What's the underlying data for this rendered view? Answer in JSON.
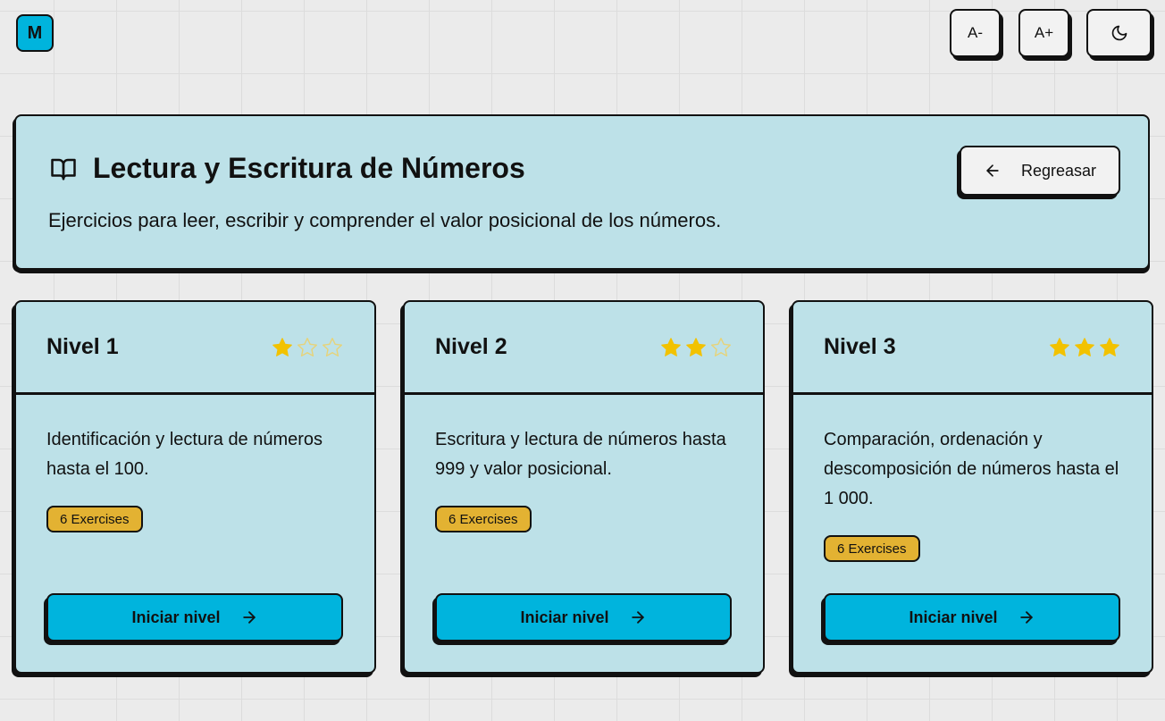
{
  "app": {
    "logo_letter": "M"
  },
  "toolbar": {
    "decrease_font_label": "A-",
    "increase_font_label": "A+",
    "theme_icon": "moon-icon"
  },
  "header": {
    "icon": "book-open-icon",
    "title": "Lectura y Escritura de Números",
    "subtitle": "Ejercicios para leer, escribir y comprender el valor posicional de los números.",
    "back_label": "Regreasar",
    "back_icon": "arrow-left-icon"
  },
  "levels": [
    {
      "title": "Nivel 1",
      "stars": 1,
      "description": "Identificación y lectura de números hasta el 100.",
      "badge": "6 Exercises",
      "button": "Iniciar nivel"
    },
    {
      "title": "Nivel 2",
      "stars": 2,
      "description": "Escritura y lectura de números hasta 999 y valor posicional.",
      "badge": "6 Exercises",
      "button": "Iniciar nivel"
    },
    {
      "title": "Nivel 3",
      "stars": 3,
      "description": "Comparación, ordenación y descomposición de números hasta el 1 000.",
      "badge": "6 Exercises",
      "button": "Iniciar nivel"
    }
  ],
  "stars_max": 3,
  "colors": {
    "accent": "#00b4dd",
    "card": "#bde1e8",
    "badge": "#e3b232",
    "star_filled": "#f2c200",
    "star_empty": "#e6d37a"
  }
}
